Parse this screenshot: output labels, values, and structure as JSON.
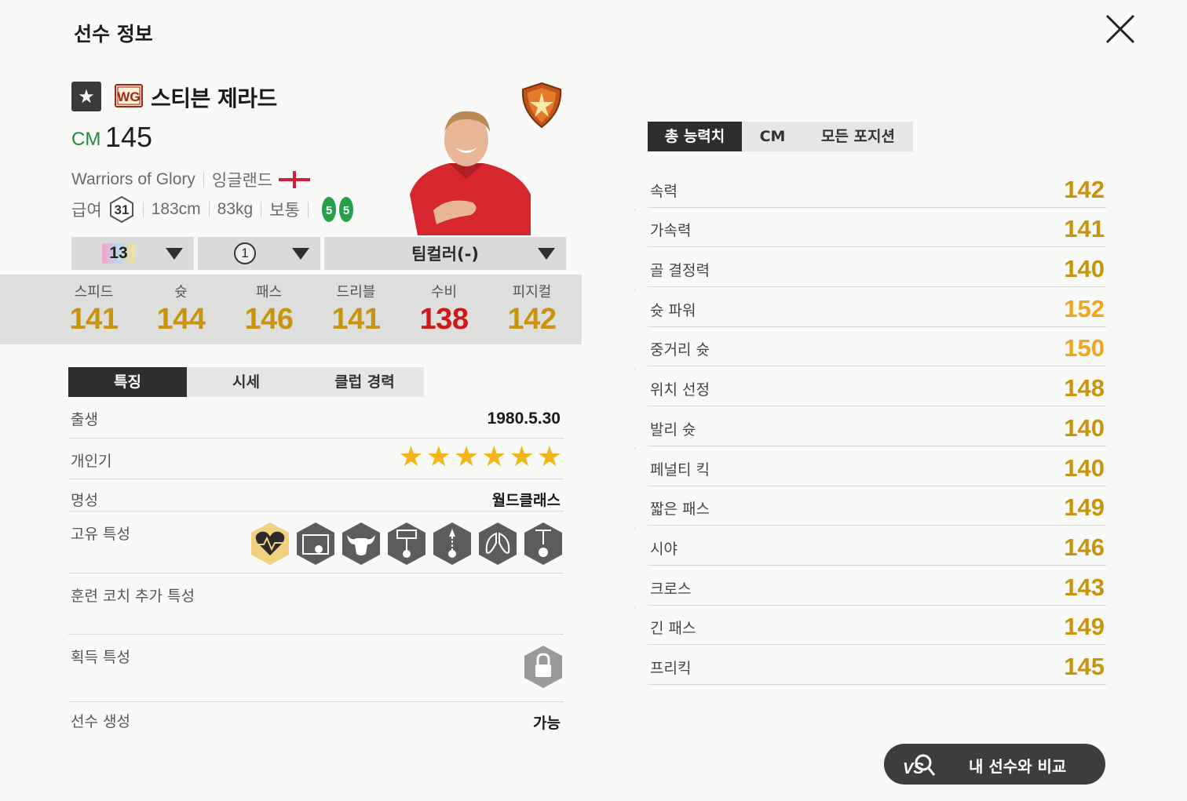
{
  "header": {
    "title": "선수 정보"
  },
  "player": {
    "season_badge": "WG",
    "name": "스티븐 제라드",
    "position": "CM",
    "overall": "145",
    "team": "Warriors of Glory",
    "nation": "잉글랜드",
    "salary_label": "급여",
    "salary": "31",
    "height": "183cm",
    "weight": "83kg",
    "body_type": "보통",
    "left_foot": "5",
    "right_foot": "5"
  },
  "dropdowns": {
    "enhance_level": "13",
    "option_count": "1",
    "team_color": "팀컬러(-)"
  },
  "summary_stats": [
    {
      "label": "스피드",
      "value": "141"
    },
    {
      "label": "슛",
      "value": "144"
    },
    {
      "label": "패스",
      "value": "146"
    },
    {
      "label": "드리블",
      "value": "141"
    },
    {
      "label": "수비",
      "value": "138"
    },
    {
      "label": "피지컬",
      "value": "142"
    }
  ],
  "tabs": [
    "특징",
    "시세",
    "클럽 경력"
  ],
  "details": {
    "birth_label": "출생",
    "birth": "1980.5.30",
    "popularity_label": "개인기",
    "popularity_stars": 6,
    "reputation_label": "명성",
    "reputation": "월드클래스",
    "traits_label": "고유 특성",
    "traits": [
      "heart-trait-icon",
      "long-shot-trait-icon",
      "bull-trait-icon",
      "playmaker-trait-icon",
      "long-pass-trait-icon",
      "lungs-trait-icon",
      "cross-trait-icon"
    ],
    "coach_traits_label": "훈련 코치 추가 특성",
    "acquired_traits_label": "획득 특성",
    "creation_label": "선수 생성",
    "creation": "가능"
  },
  "right_tabs": [
    "총 능력치",
    "CM",
    "모든 포지션"
  ],
  "attributes": [
    {
      "label": "속력",
      "value": "142"
    },
    {
      "label": "가속력",
      "value": "141"
    },
    {
      "label": "골 결정력",
      "value": "140"
    },
    {
      "label": "슛 파워",
      "value": "152"
    },
    {
      "label": "중거리 슛",
      "value": "150"
    },
    {
      "label": "위치 선정",
      "value": "148"
    },
    {
      "label": "발리 슛",
      "value": "140"
    },
    {
      "label": "페널티 킥",
      "value": "140"
    },
    {
      "label": "짧은 패스",
      "value": "149"
    },
    {
      "label": "시야",
      "value": "146"
    },
    {
      "label": "크로스",
      "value": "143"
    },
    {
      "label": "긴 패스",
      "value": "149"
    },
    {
      "label": "프리킥",
      "value": "145"
    }
  ],
  "compare_button": {
    "icon": "VS",
    "label": "내 선수와 비교"
  },
  "colors": {
    "gold": "#c7940c",
    "orange": "#f0a51a",
    "red": "#d01818",
    "green": "#1f8c3a",
    "dark": "#2e2e2e"
  }
}
